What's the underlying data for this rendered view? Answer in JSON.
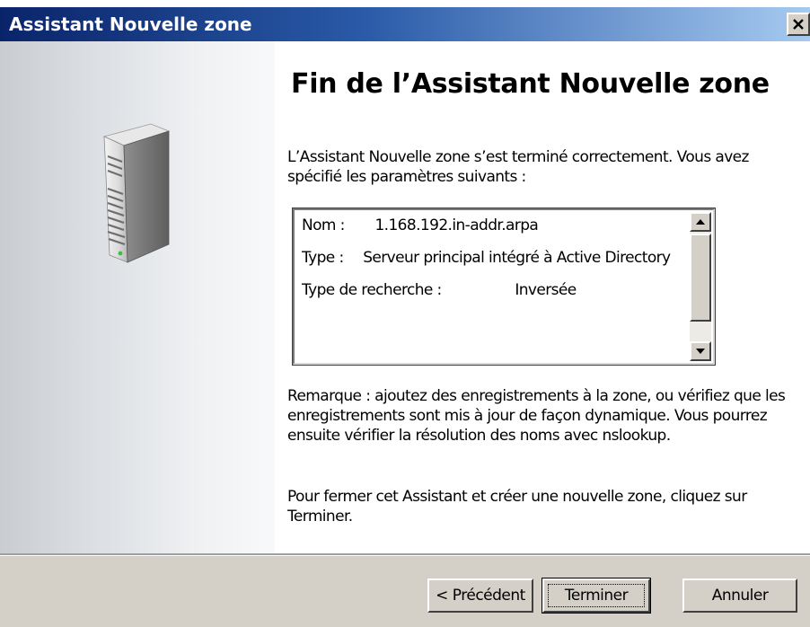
{
  "window": {
    "title": "Assistant Nouvelle zone",
    "close_symbol": "×"
  },
  "wizard": {
    "heading": "Fin de l’Assistant Nouvelle zone",
    "intro": "L’Assistant Nouvelle zone s’est terminé correctement. Vous avez spécifié les paramètres suivants :",
    "summary": {
      "name_label": "Nom :",
      "name_value": "1.168.192.in-addr.arpa",
      "type_label": "Type :",
      "type_value": "Serveur principal intégré à Active Directory",
      "search_type_label": "Type de recherche :",
      "search_type_value": "Inversée"
    },
    "note": "Remarque : ajoutez des enregistrements à la zone, ou vérifiez que les enregistrements sont mis à jour de façon dynamique. Vous pourrez ensuite vérifier la résolution des noms avec nslookup.",
    "closing": "Pour fermer cet Assistant et créer une nouvelle zone, cliquez sur Terminer."
  },
  "buttons": {
    "previous": "< Précédent",
    "finish": "Terminer",
    "cancel": "Annuler"
  },
  "icons": {
    "close": "close-icon",
    "server": "server-icon",
    "scroll_up": "arrow-up-icon",
    "scroll_down": "arrow-down-icon"
  },
  "colors": {
    "titlebar_start": "#0a246a",
    "titlebar_end": "#a6caf0",
    "button_face": "#d4d0c8"
  }
}
